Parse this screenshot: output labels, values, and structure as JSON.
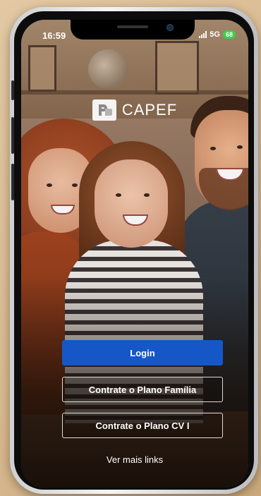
{
  "status_bar": {
    "time": "16:59",
    "network": "5G",
    "battery": "68"
  },
  "brand": {
    "name": "CAPEF",
    "icon": "capef-logo-icon"
  },
  "buttons": {
    "login": "Login",
    "plano_familia": "Contrate o Plano Família",
    "plano_cv": "Contrate o Plano CV I"
  },
  "links": {
    "more": "Ver mais links"
  },
  "colors": {
    "primary": "#1657c8",
    "battery": "#3ccf4e"
  }
}
